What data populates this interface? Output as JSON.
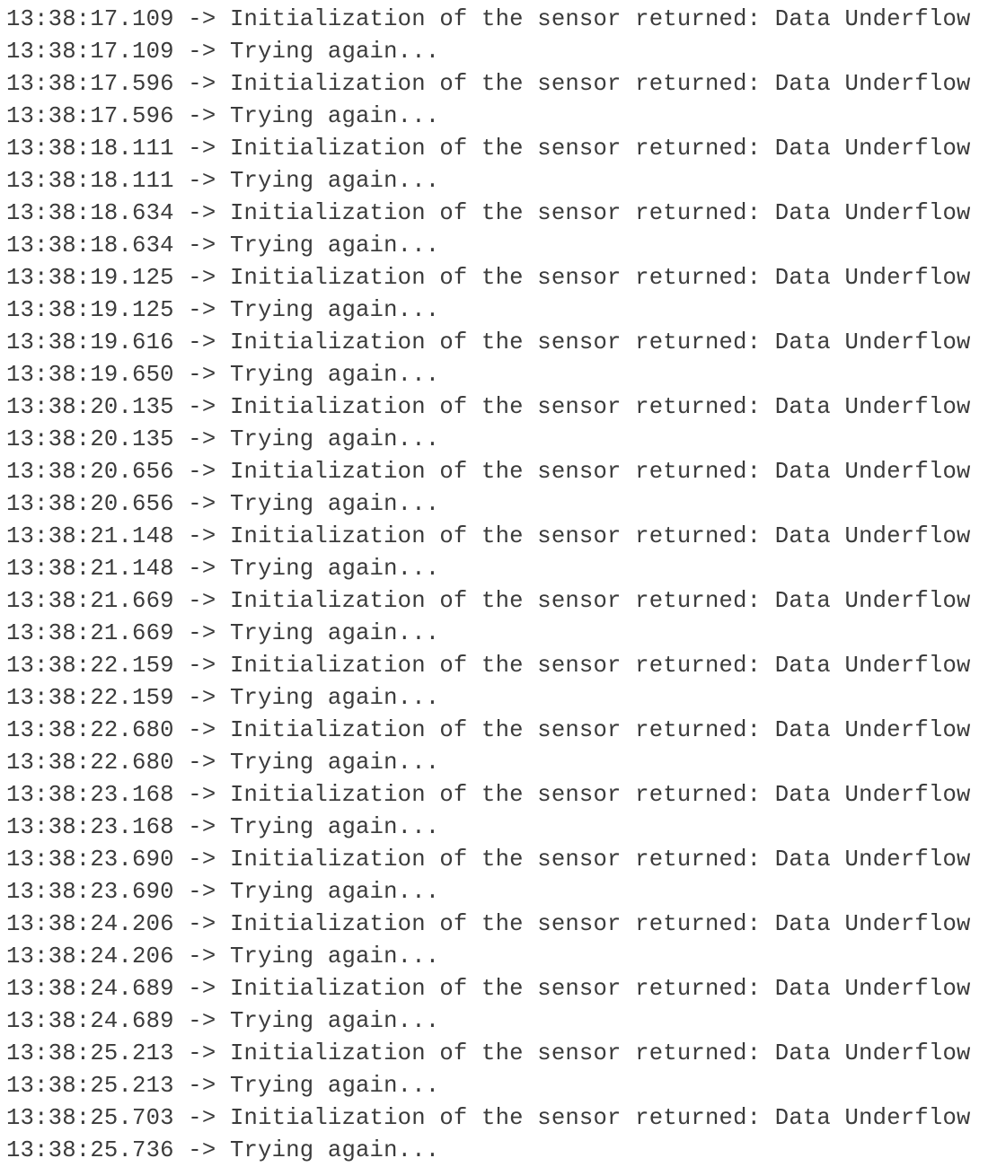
{
  "log": {
    "separator": " -> ",
    "lines": [
      {
        "time": "13:38:17.109",
        "message": "Initialization of the sensor returned: Data Underflow"
      },
      {
        "time": "13:38:17.109",
        "message": "Trying again..."
      },
      {
        "time": "13:38:17.596",
        "message": "Initialization of the sensor returned: Data Underflow"
      },
      {
        "time": "13:38:17.596",
        "message": "Trying again..."
      },
      {
        "time": "13:38:18.111",
        "message": "Initialization of the sensor returned: Data Underflow"
      },
      {
        "time": "13:38:18.111",
        "message": "Trying again..."
      },
      {
        "time": "13:38:18.634",
        "message": "Initialization of the sensor returned: Data Underflow"
      },
      {
        "time": "13:38:18.634",
        "message": "Trying again..."
      },
      {
        "time": "13:38:19.125",
        "message": "Initialization of the sensor returned: Data Underflow"
      },
      {
        "time": "13:38:19.125",
        "message": "Trying again..."
      },
      {
        "time": "13:38:19.616",
        "message": "Initialization of the sensor returned: Data Underflow"
      },
      {
        "time": "13:38:19.650",
        "message": "Trying again..."
      },
      {
        "time": "13:38:20.135",
        "message": "Initialization of the sensor returned: Data Underflow"
      },
      {
        "time": "13:38:20.135",
        "message": "Trying again..."
      },
      {
        "time": "13:38:20.656",
        "message": "Initialization of the sensor returned: Data Underflow"
      },
      {
        "time": "13:38:20.656",
        "message": "Trying again..."
      },
      {
        "time": "13:38:21.148",
        "message": "Initialization of the sensor returned: Data Underflow"
      },
      {
        "time": "13:38:21.148",
        "message": "Trying again..."
      },
      {
        "time": "13:38:21.669",
        "message": "Initialization of the sensor returned: Data Underflow"
      },
      {
        "time": "13:38:21.669",
        "message": "Trying again..."
      },
      {
        "time": "13:38:22.159",
        "message": "Initialization of the sensor returned: Data Underflow"
      },
      {
        "time": "13:38:22.159",
        "message": "Trying again..."
      },
      {
        "time": "13:38:22.680",
        "message": "Initialization of the sensor returned: Data Underflow"
      },
      {
        "time": "13:38:22.680",
        "message": "Trying again..."
      },
      {
        "time": "13:38:23.168",
        "message": "Initialization of the sensor returned: Data Underflow"
      },
      {
        "time": "13:38:23.168",
        "message": "Trying again..."
      },
      {
        "time": "13:38:23.690",
        "message": "Initialization of the sensor returned: Data Underflow"
      },
      {
        "time": "13:38:23.690",
        "message": "Trying again..."
      },
      {
        "time": "13:38:24.206",
        "message": "Initialization of the sensor returned: Data Underflow"
      },
      {
        "time": "13:38:24.206",
        "message": "Trying again..."
      },
      {
        "time": "13:38:24.689",
        "message": "Initialization of the sensor returned: Data Underflow"
      },
      {
        "time": "13:38:24.689",
        "message": "Trying again..."
      },
      {
        "time": "13:38:25.213",
        "message": "Initialization of the sensor returned: Data Underflow"
      },
      {
        "time": "13:38:25.213",
        "message": "Trying again..."
      },
      {
        "time": "13:38:25.703",
        "message": "Initialization of the sensor returned: Data Underflow"
      },
      {
        "time": "13:38:25.736",
        "message": "Trying again..."
      }
    ]
  },
  "colors": {
    "text": "#3b3b3b",
    "background": "#ffffff"
  }
}
